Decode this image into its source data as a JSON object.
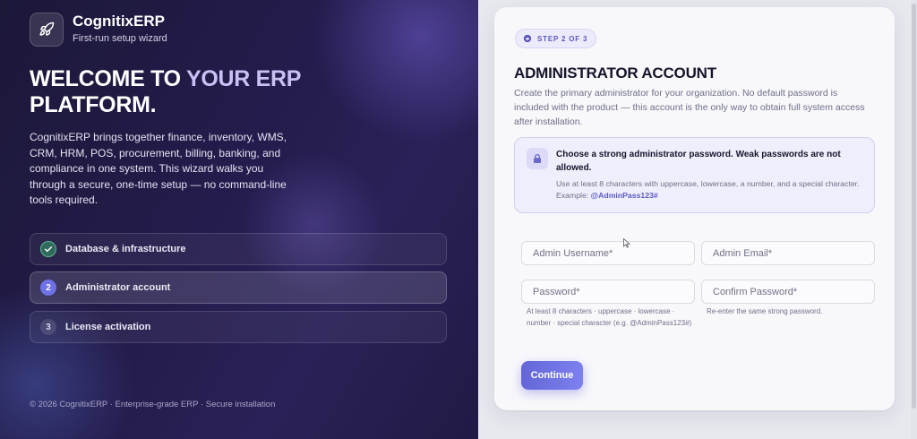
{
  "brand": {
    "name": "CognitixERP",
    "subtitle": "First-run setup wizard",
    "logo_icon": "rocket-icon"
  },
  "hero": {
    "title_part1": "WELCOME TO ",
    "title_accent": "YOUR ERP",
    "title_part2": " PLATFORM.",
    "intro": "CognitixERP brings together finance, inventory, WMS, CRM, HRM, POS, procurement, billing, banking, and compliance in one system. This wizard walks you through a secure, one-time setup — no command-line tools required."
  },
  "steps": [
    {
      "badge": "✓",
      "label": "Database & infrastructure",
      "state": "done"
    },
    {
      "badge": "2",
      "label": "Administrator account",
      "state": "current"
    },
    {
      "badge": "3",
      "label": "License activation",
      "state": "pending"
    }
  ],
  "footer": "© 2026 CognitixERP · Enterprise-grade ERP · Secure installation",
  "card": {
    "step_chip": "STEP 2 OF 3",
    "title": "ADMINISTRATOR ACCOUNT",
    "description": "Create the primary administrator for your organization. No default password is included with the product — this account is the only way to obtain full system access after installation.",
    "alert": {
      "icon": "lock-icon",
      "title": "Choose a strong administrator password. Weak passwords are not allowed.",
      "text": "Use at least 8 characters with uppercase, lowercase, a number, and a special character. Example: ",
      "example": "@AdminPass123#"
    },
    "fields": {
      "username_placeholder": "Admin Username*",
      "email_placeholder": "Admin Email*",
      "password_placeholder": "Password*",
      "confirm_placeholder": "Confirm Password*",
      "password_hint": "At least 8 characters · uppercase · lowercase · number · special character (e.g. @AdminPass123#)",
      "confirm_hint": "Re-enter the same strong password."
    },
    "continue_label": "Continue"
  },
  "colors": {
    "accent": "#6466d8",
    "left_panel_bg": "#241c4c",
    "done_badge": "#5fb59a"
  }
}
